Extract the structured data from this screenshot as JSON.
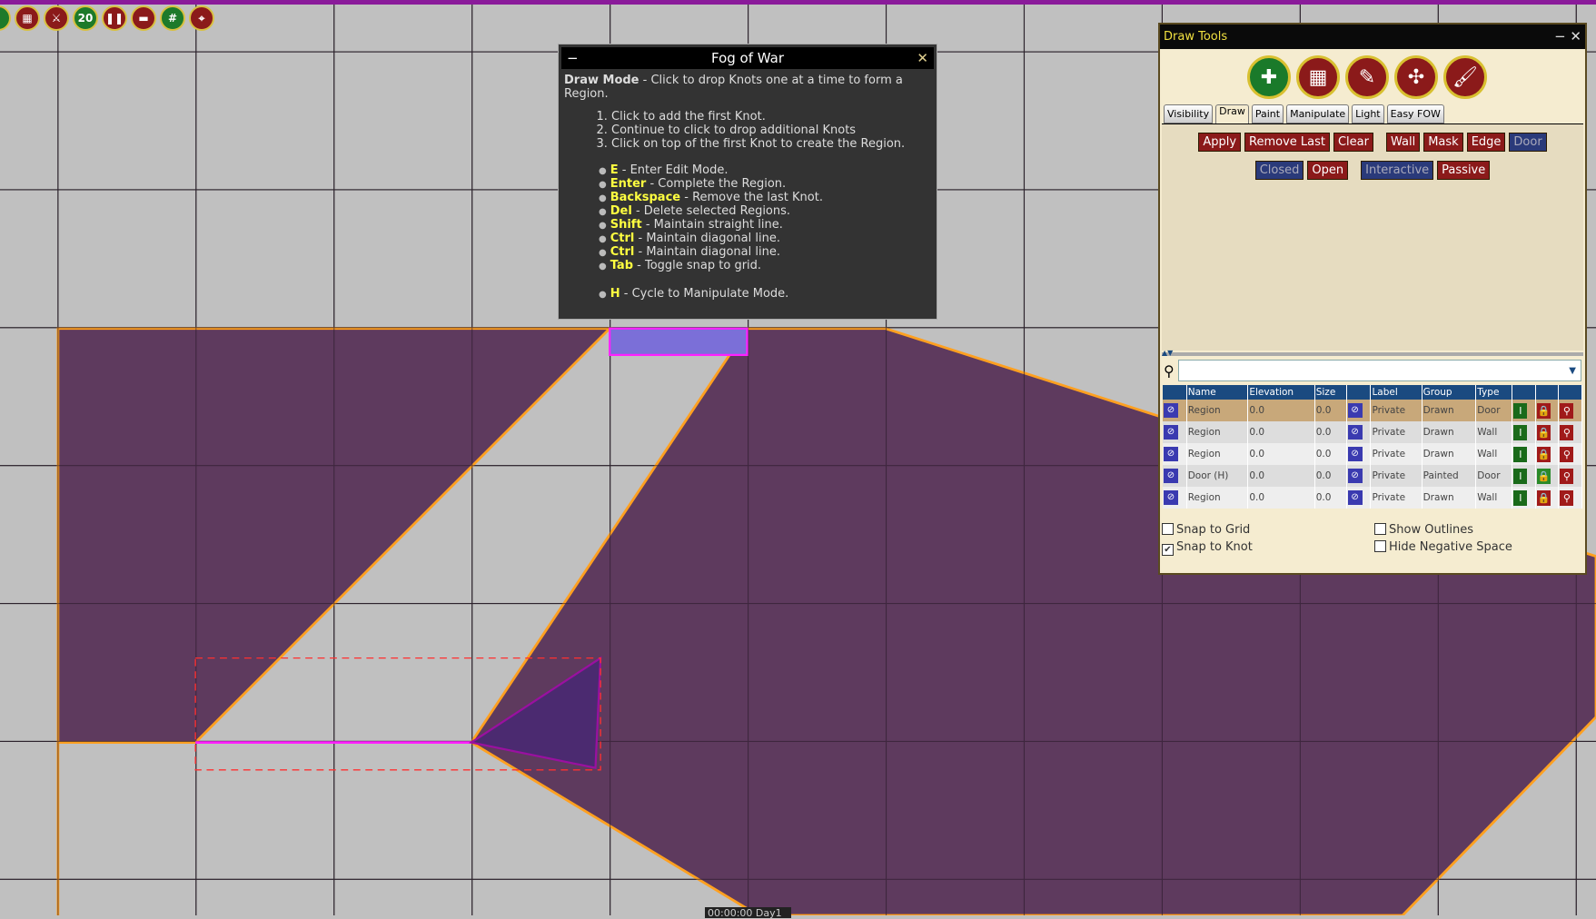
{
  "toolbar": {
    "icons": [
      "green-icon",
      "grid-arrow-icon",
      "crossed-swords-icon",
      "d20-icon",
      "pause-icon",
      "ruler-icon",
      "grid-icon",
      "map-pin-icon"
    ],
    "d20_label": "20"
  },
  "fog": {
    "title": "Fog of War",
    "mode": "Draw Mode",
    "intro": " - Click to drop Knots one at a time to form a Region.",
    "steps": [
      "Click to add the first Knot.",
      "Continue to click to drop additional Knots",
      "Click on top of the first Knot to create the Region."
    ],
    "keys": [
      {
        "k": "E",
        "d": " - Enter Edit Mode."
      },
      {
        "k": "Enter",
        "d": " - Complete the Region."
      },
      {
        "k": "Backspace",
        "d": " - Remove the last Knot."
      },
      {
        "k": "Del",
        "d": " - Delete selected Regions."
      },
      {
        "k": "Shift",
        "d": " - Maintain straight line."
      },
      {
        "k": "Ctrl",
        "d": " - Maintain diagonal line."
      },
      {
        "k": "Ctrl",
        "d": " - Maintain diagonal line."
      },
      {
        "k": "Tab",
        "d": " - Toggle snap to grid."
      },
      {
        "k": "H",
        "d": " - Cycle to Manipulate Mode."
      }
    ]
  },
  "draw_tools": {
    "title": "Draw Tools",
    "tabs": [
      "Visibility",
      "Draw",
      "Paint",
      "Manipulate",
      "Light",
      "Easy FOW"
    ],
    "active_tab": "Draw",
    "row1": [
      "Apply",
      "Remove Last",
      "Clear",
      "Wall",
      "Mask",
      "Edge",
      "Door"
    ],
    "row2": [
      "Closed",
      "Open",
      "Interactive",
      "Passive"
    ],
    "search_placeholder": "",
    "columns": [
      "Name",
      "Elevation",
      "Size",
      "Label",
      "Group",
      "Type"
    ],
    "rows": [
      {
        "name": "Region",
        "elevation": "0.0",
        "size": "0.0",
        "label": "Private",
        "group": "Drawn",
        "type": "Door"
      },
      {
        "name": "Region",
        "elevation": "0.0",
        "size": "0.0",
        "label": "Private",
        "group": "Drawn",
        "type": "Wall"
      },
      {
        "name": "Region",
        "elevation": "0.0",
        "size": "0.0",
        "label": "Private",
        "group": "Drawn",
        "type": "Wall"
      },
      {
        "name": "Door (H)",
        "elevation": "0.0",
        "size": "0.0",
        "label": "Private",
        "group": "Painted",
        "type": "Door"
      },
      {
        "name": "Region",
        "elevation": "0.0",
        "size": "0.0",
        "label": "Private",
        "group": "Drawn",
        "type": "Wall"
      }
    ],
    "options": [
      {
        "label": "Snap to Grid",
        "checked": false
      },
      {
        "label": "Show Outlines",
        "checked": false
      },
      {
        "label": "Snap to Knot",
        "checked": true
      },
      {
        "label": "Hide Negative Space",
        "checked": false
      }
    ]
  },
  "clock": "00:00:00 Day1",
  "colors": {
    "region_fill": "#5e3a5e",
    "outline": "#ffa020",
    "selected": "#ff20ff",
    "background": "#c0c0c0"
  }
}
